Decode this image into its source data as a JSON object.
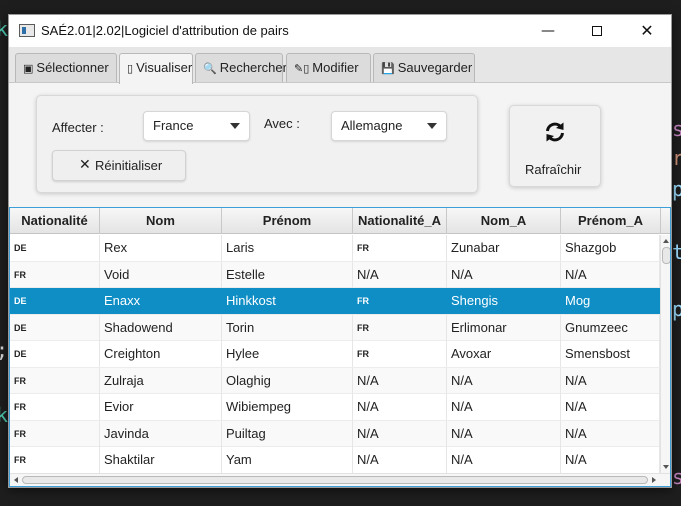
{
  "window": {
    "title": "SAÉ2.01|2.02|Logiciel d'attribution de pairs",
    "minimize_glyph": "—",
    "close_glyph": "✕"
  },
  "tabs": [
    {
      "label": "Sélectionner",
      "icon": "grid-icon",
      "glyph": "▣"
    },
    {
      "label": "Visualiser",
      "icon": "missing-glyph-icon",
      "glyph": "▯"
    },
    {
      "label": "Rechercher",
      "icon": "search-icon",
      "glyph": "🔍"
    },
    {
      "label": "Modifier",
      "icon": "edit-icon",
      "glyph": "✎▯"
    },
    {
      "label": "Sauvegarder",
      "icon": "save-icon",
      "glyph": "💾"
    }
  ],
  "active_tab": "Visualiser",
  "affect_panel": {
    "affecter_label": "Affecter :",
    "avec_label": "Avec :",
    "pays_a": "France",
    "pays_b": "Allemagne",
    "reset_label": "Réinitialiser",
    "reset_glyph": "✕"
  },
  "refresh": {
    "label": "Rafraîchir",
    "icon": "refresh-icon"
  },
  "table": {
    "columns": [
      "Nationalité",
      "Nom",
      "Prénom",
      "Nationalité_A",
      "Nom_A",
      "Prénom_A"
    ],
    "selected_row": 2,
    "rows": [
      [
        "DE",
        "Rex",
        "Laris",
        "FR",
        "Zunabar",
        "Shazgob"
      ],
      [
        "FR",
        "Void",
        "Estelle",
        "N/A",
        "N/A",
        "N/A"
      ],
      [
        "DE",
        "Enaxx",
        "Hinkkost",
        "FR",
        "Shengis",
        "Mog"
      ],
      [
        "DE",
        "Shadowend",
        "Torin",
        "FR",
        "Erlimonar",
        "Gnumzeec"
      ],
      [
        "DE",
        "Creighton",
        "Hylee",
        "FR",
        "Avoxar",
        "Smensbost"
      ],
      [
        "FR",
        "Zulraja",
        "Olaghig",
        "N/A",
        "N/A",
        "N/A"
      ],
      [
        "FR",
        "Evior",
        "Wibiempeg",
        "N/A",
        "N/A",
        "N/A"
      ],
      [
        "FR",
        "Javinda",
        "Puiltag",
        "N/A",
        "N/A",
        "N/A"
      ],
      [
        "FR",
        "Shaktilar",
        "Yam",
        "N/A",
        "N/A",
        "N/A"
      ]
    ]
  },
  "background_code": [
    {
      "text": "k",
      "color": "#4ec9b0"
    },
    {
      "text": "s",
      "color": "#c586c0"
    },
    {
      "text": "r",
      "color": "#ce9178"
    },
    {
      "text": "p",
      "color": "#9cdcfe"
    },
    {
      "text": "t",
      "color": "#9cdcfe"
    },
    {
      "text": ";",
      "color": "#d4d4d4"
    },
    {
      "text": "p",
      "color": "#9cdcfe"
    },
    {
      "text": "k",
      "color": "#4ec9b0"
    },
    {
      "text": "s",
      "color": "#c586c0"
    },
    {
      "text": "_",
      "color": "#dcdcaa"
    }
  ]
}
